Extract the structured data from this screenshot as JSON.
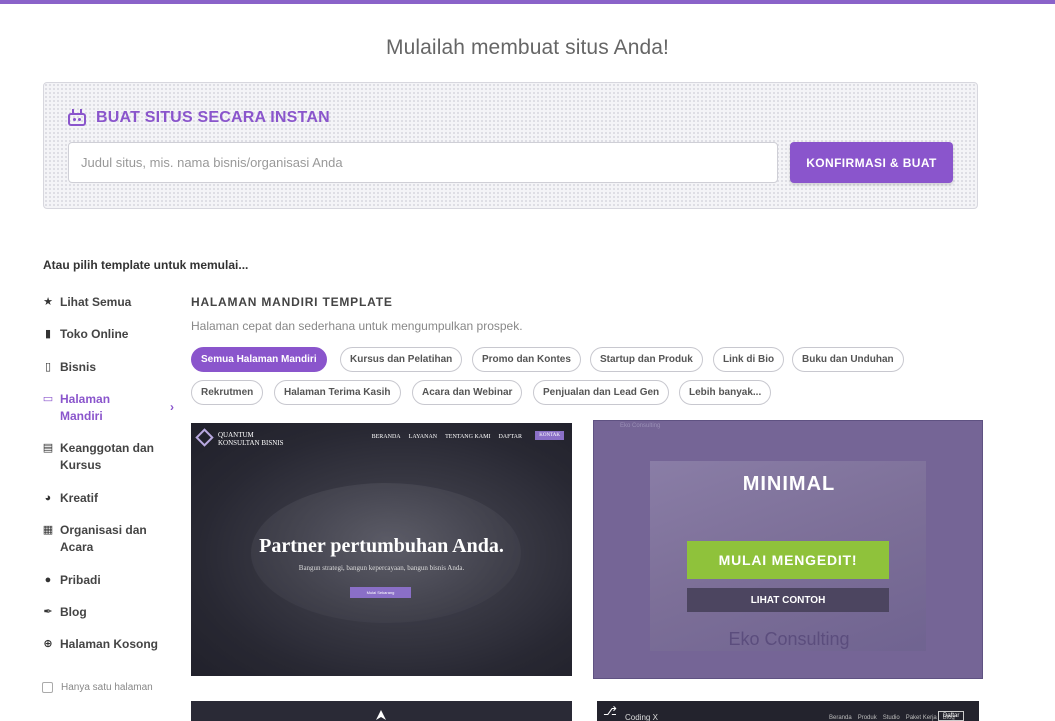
{
  "headline": "Mulailah membuat situs Anda!",
  "instant": {
    "title": "BUAT SITUS SECARA INSTAN",
    "placeholder": "Judul situs, mis. nama bisnis/organisasi Anda",
    "value": "",
    "button": "KONFIRMASI & BUAT",
    "icon": "robot-icon",
    "accent_color": "#8a55cc"
  },
  "or_choose": "Atau pilih template untuk memulai...",
  "sidebar": {
    "items": [
      {
        "label": "Lihat Semua",
        "icon": "star-icon",
        "glyph": "★"
      },
      {
        "label": "Toko Online",
        "icon": "cart-icon",
        "glyph": "🛒"
      },
      {
        "label": "Bisnis",
        "icon": "clipboard-icon",
        "glyph": "▯"
      },
      {
        "label": "Halaman Mandiri",
        "icon": "window-icon",
        "glyph": "▭",
        "active": true
      },
      {
        "label": "Keanggotan dan Kursus",
        "icon": "id-card-icon",
        "glyph": "▤"
      },
      {
        "label": "Kreatif",
        "icon": "palette-icon",
        "glyph": "◕"
      },
      {
        "label": "Organisasi dan Acara",
        "icon": "calendar-icon",
        "glyph": "▦"
      },
      {
        "label": "Pribadi",
        "icon": "user-icon",
        "glyph": "●"
      },
      {
        "label": "Blog",
        "icon": "feather-icon",
        "glyph": "✒"
      },
      {
        "label": "Halaman Kosong",
        "icon": "plus-circle-icon",
        "glyph": "⊕"
      }
    ],
    "single_page_label": "Hanya satu halaman",
    "single_page_checked": false
  },
  "section": {
    "title": "HALAMAN MANDIRI TEMPLATE",
    "description": "Halaman cepat dan sederhana untuk mengumpulkan prospek."
  },
  "filters": [
    {
      "label": "Semua Halaman Mandiri",
      "active": true
    },
    {
      "label": "Kursus dan Pelatihan"
    },
    {
      "label": "Promo dan Kontes"
    },
    {
      "label": "Startup dan Produk"
    },
    {
      "label": "Link di Bio"
    },
    {
      "label": "Buku dan Unduhan"
    },
    {
      "label": "Rekrutmen"
    },
    {
      "label": "Halaman Terima Kasih"
    },
    {
      "label": "Acara dan Webinar"
    },
    {
      "label": "Penjualan dan Lead Gen"
    },
    {
      "label": "Lebih banyak..."
    }
  ],
  "templates": [
    {
      "logo_line1": "QUANTUM",
      "logo_line2": "KONSULTAN BISNIS",
      "nav": [
        "BERANDA",
        "LAYANAN",
        "TENTANG KAMI",
        "DAFTAR"
      ],
      "contact": "KONTAK",
      "heading": "Partner pertumbuhan Anda.",
      "sub": "Bangun strategi, bangun kepercayaan, bangun bisnis Anda.",
      "button": "Mulai Sekarang"
    },
    {
      "top_text": "Eko Consulting",
      "title": "MINIMAL",
      "edit_button": "MULAI MENGEDIT!",
      "preview_button": "LIHAT CONTOH",
      "brand": "Eko Consulting"
    },
    {
      "icon": "rocket-icon"
    },
    {
      "name": "Coding X",
      "nav": [
        "Beranda",
        "Produk",
        "Studio",
        "Paket Kerja",
        "Blog"
      ],
      "button": "Daftar"
    }
  ]
}
